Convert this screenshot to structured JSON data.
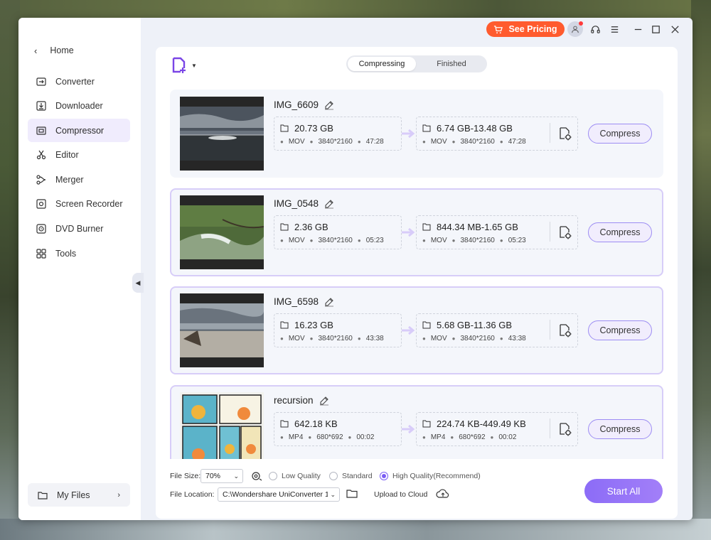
{
  "sidebar": {
    "home_label": "Home",
    "items": [
      {
        "label": "Converter",
        "icon": "converter-icon"
      },
      {
        "label": "Downloader",
        "icon": "downloader-icon"
      },
      {
        "label": "Compressor",
        "icon": "compressor-icon",
        "active": true
      },
      {
        "label": "Editor",
        "icon": "scissors-icon"
      },
      {
        "label": "Merger",
        "icon": "merger-icon"
      },
      {
        "label": "Screen Recorder",
        "icon": "screen-recorder-icon"
      },
      {
        "label": "DVD Burner",
        "icon": "dvd-icon"
      },
      {
        "label": "Tools",
        "icon": "grid-icon"
      }
    ],
    "my_files_label": "My Files"
  },
  "titlebar": {
    "pricing_label": "See Pricing",
    "accent_color": "#ff5b2e"
  },
  "tabs": {
    "compressing": "Compressing",
    "finished": "Finished"
  },
  "files": [
    {
      "name": "IMG_6609",
      "src_size": "20.73 GB",
      "src_format": "MOV",
      "src_res": "3840*2160",
      "src_dur": "47:28",
      "dst_size": "6.74 GB-13.48 GB",
      "dst_format": "MOV",
      "dst_res": "3840*2160",
      "dst_dur": "47:28",
      "button": "Compress"
    },
    {
      "name": "IMG_0548",
      "src_size": "2.36 GB",
      "src_format": "MOV",
      "src_res": "3840*2160",
      "src_dur": "05:23",
      "dst_size": "844.34 MB-1.65 GB",
      "dst_format": "MOV",
      "dst_res": "3840*2160",
      "dst_dur": "05:23",
      "button": "Compress"
    },
    {
      "name": "IMG_6598",
      "src_size": "16.23 GB",
      "src_format": "MOV",
      "src_res": "3840*2160",
      "src_dur": "43:38",
      "dst_size": "5.68 GB-11.36 GB",
      "dst_format": "MOV",
      "dst_res": "3840*2160",
      "dst_dur": "43:38",
      "button": "Compress"
    },
    {
      "name": "recursion",
      "src_size": "642.18 KB",
      "src_format": "MP4",
      "src_res": "680*692",
      "src_dur": "00:02",
      "dst_size": "224.74 KB-449.49 KB",
      "dst_format": "MP4",
      "dst_res": "680*692",
      "dst_dur": "00:02",
      "button": "Compress"
    }
  ],
  "bottom": {
    "file_size_label": "File Size:",
    "file_size_value": "70%",
    "quality_low": "Low Quality",
    "quality_standard": "Standard",
    "quality_high": "High Quality(Recommend)",
    "file_location_label": "File Location:",
    "file_location_value": "C:\\Wondershare UniConverter 1",
    "upload_label": "Upload to Cloud",
    "start_all": "Start All",
    "accent_color": "#8c6cf7"
  }
}
